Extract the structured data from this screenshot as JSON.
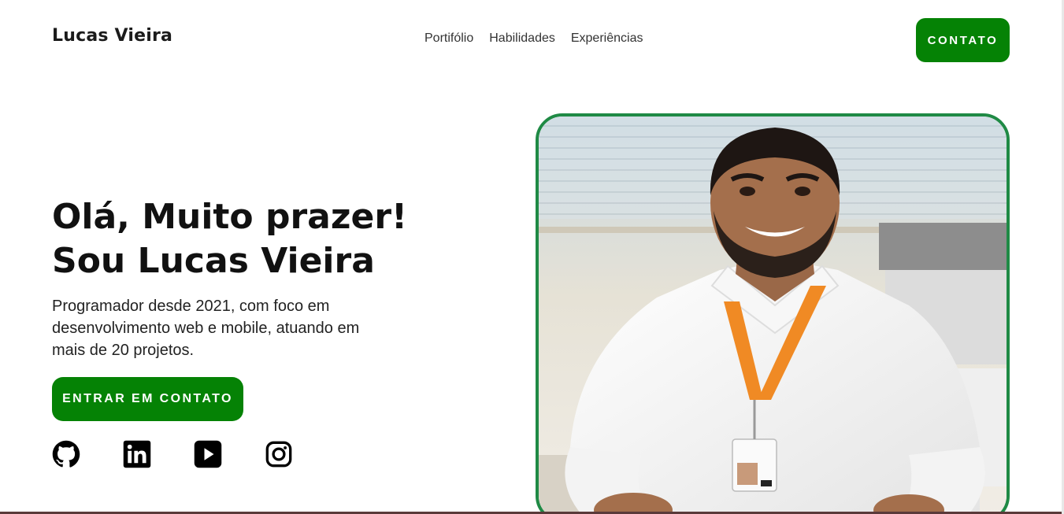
{
  "header": {
    "brand": "Lucas Vieira",
    "nav": [
      "Portifólio",
      "Habilidades",
      "Experiências"
    ],
    "contact_button": "CONTATO"
  },
  "hero": {
    "title_line1": "Olá, Muito prazer!",
    "title_line2": "Sou Lucas Vieira",
    "description": "Programador desde 2021, com foco em desenvolvimento web e mobile, atuando em mais de 20 projetos.",
    "cta_button": "ENTRAR EM CONTATO"
  },
  "socials": [
    {
      "icon": "github-icon"
    },
    {
      "icon": "linkedin-icon"
    },
    {
      "icon": "youtube-icon"
    },
    {
      "icon": "instagram-icon"
    }
  ],
  "colors": {
    "accent": "#058205",
    "frame_border": "#1f8a45",
    "text": "#111111"
  }
}
